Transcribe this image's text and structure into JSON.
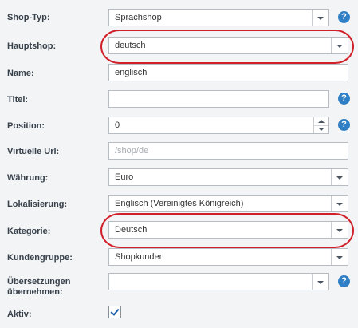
{
  "form": {
    "shop_type": {
      "label": "Shop-Typ:",
      "value": "Sprachshop"
    },
    "main_shop": {
      "label": "Hauptshop:",
      "value": "deutsch"
    },
    "name": {
      "label": "Name:",
      "value": "englisch"
    },
    "title": {
      "label": "Titel:",
      "value": ""
    },
    "position": {
      "label": "Position:",
      "value": "0"
    },
    "virtual_url": {
      "label": "Virtuelle Url:",
      "placeholder": "/shop/de"
    },
    "currency": {
      "label": "Währung:",
      "value": "Euro"
    },
    "locale": {
      "label": "Lokalisierung:",
      "value": "Englisch (Vereinigtes Königreich)"
    },
    "category": {
      "label": "Kategorie:",
      "value": "Deutsch"
    },
    "customer_group": {
      "label": "Kundengruppe:",
      "value": "Shopkunden"
    },
    "translations": {
      "label_line1": "Übersetzungen",
      "label_line2": "übernehmen:",
      "value": ""
    },
    "active": {
      "label": "Aktiv:",
      "checked": true
    }
  },
  "help_icon_glyph": "?",
  "colors": {
    "background": "#f3f4f5",
    "help_icon": "#2f7fc6",
    "highlight_oval": "#d2202a",
    "checkbox_tick": "#1f5fa8"
  }
}
